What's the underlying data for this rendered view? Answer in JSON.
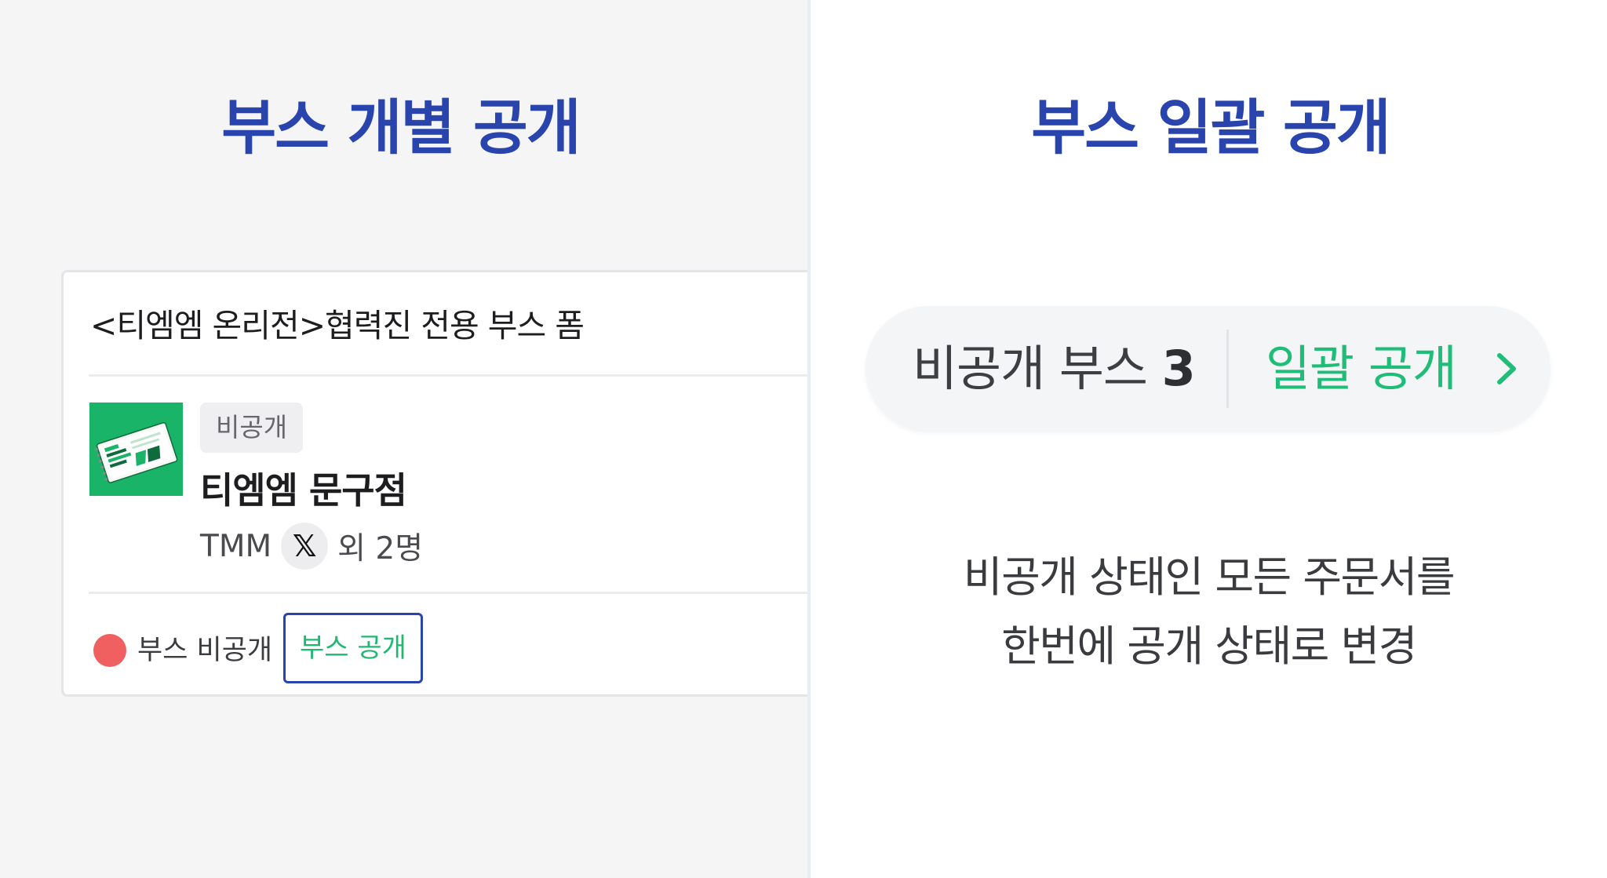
{
  "left": {
    "heading": "부스 개별 공개",
    "card": {
      "form_title": "<티엠엠 온리전>협력진 전용 부스 폼",
      "status_chip": "비공개",
      "shop_name": "티엠엠 문구점",
      "owner_name": "TMM",
      "owner_extra": "외 2명",
      "booth_status": "부스 비공개",
      "publish_button": "부스 공개"
    }
  },
  "right": {
    "heading": "부스 일괄 공개",
    "pill": {
      "private_label": "비공개 부스",
      "private_count": "3",
      "action_label": "일괄 공개"
    },
    "description": [
      "비공개 상태인 모든 주문서를",
      "한번에 공개 상태로 변경"
    ]
  },
  "colors": {
    "heading_blue": "#2a44ad",
    "accent_green": "#1fbd77",
    "status_red": "#f06060",
    "thumbnail_green": "#19b467"
  },
  "icons": {
    "x_logo": "𝕏",
    "chevron": "chevron-right-icon"
  }
}
